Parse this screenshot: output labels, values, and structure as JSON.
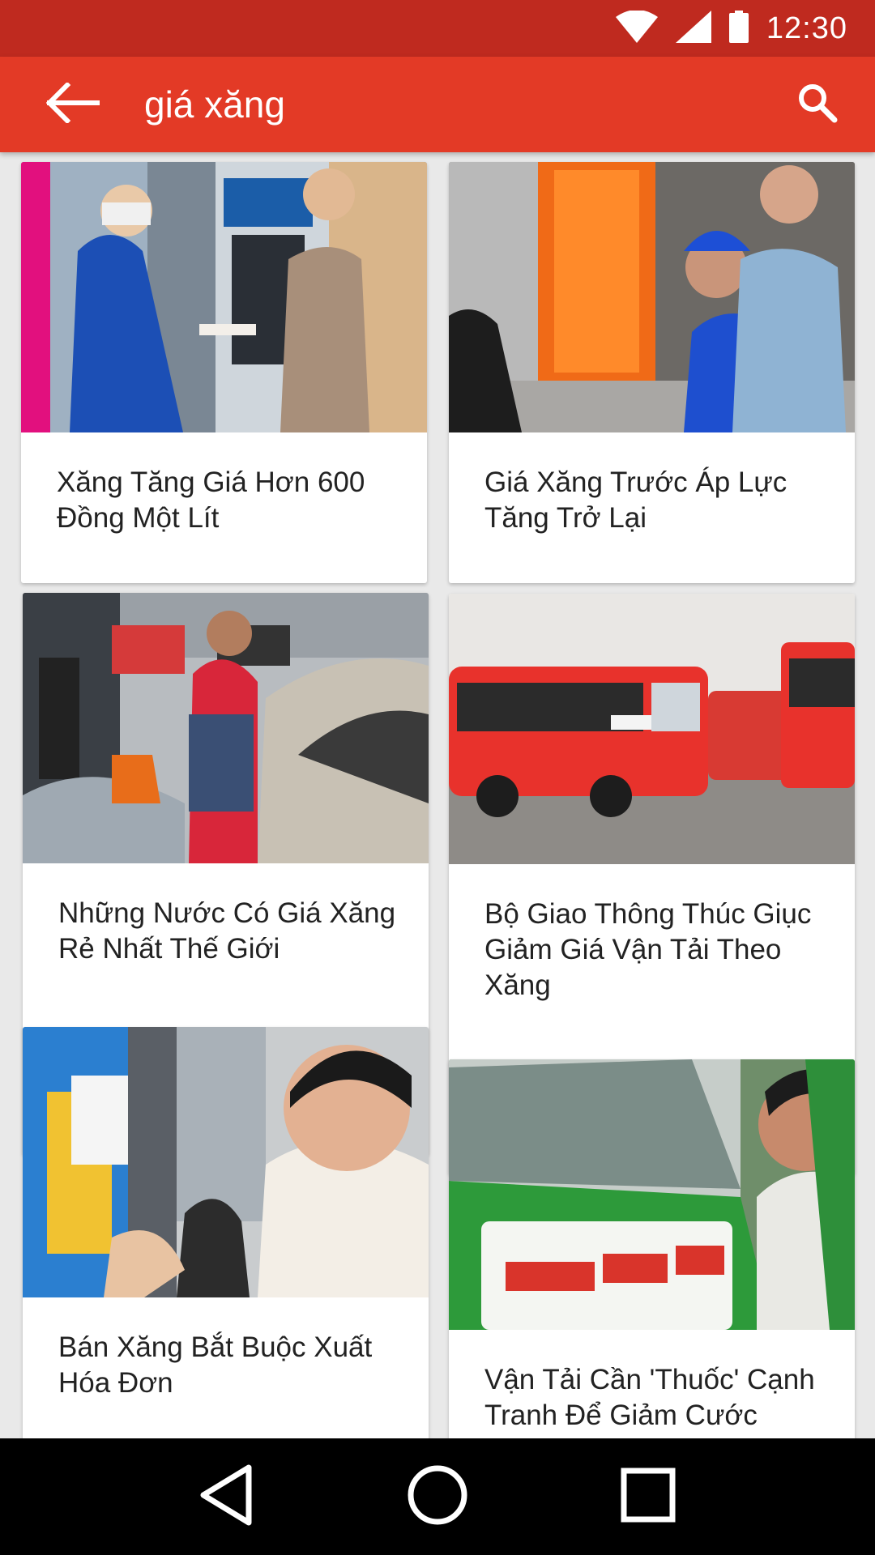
{
  "status_bar": {
    "time": "12:30",
    "icons": [
      "wifi-icon",
      "signal-icon",
      "battery-icon"
    ]
  },
  "app_bar": {
    "query": "giá xăng",
    "back_icon": "arrow-back-icon",
    "search_icon": "search-icon",
    "color": "#e33a26"
  },
  "articles": [
    {
      "title": "Xăng Tăng Giá Hơn 600 Đồng Một Lít"
    },
    {
      "title": "Giá Xăng Trước Áp Lực Tăng Trở Lại"
    },
    {
      "title": "Những Nước Có Giá Xăng Rẻ Nhất Thế Giới"
    },
    {
      "title": "Bộ Giao Thông Thúc Giục Giảm Giá Vận Tải Theo Xăng"
    },
    {
      "title": "Bán Xăng Bắt Buộc Xuất Hóa Đơn"
    },
    {
      "title": "Vận Tải Cần 'Thuốc' Cạnh Tranh Để Giảm Cước"
    }
  ],
  "nav_bar": {
    "icons": [
      "back-triangle-icon",
      "home-circle-icon",
      "recents-square-icon"
    ]
  }
}
